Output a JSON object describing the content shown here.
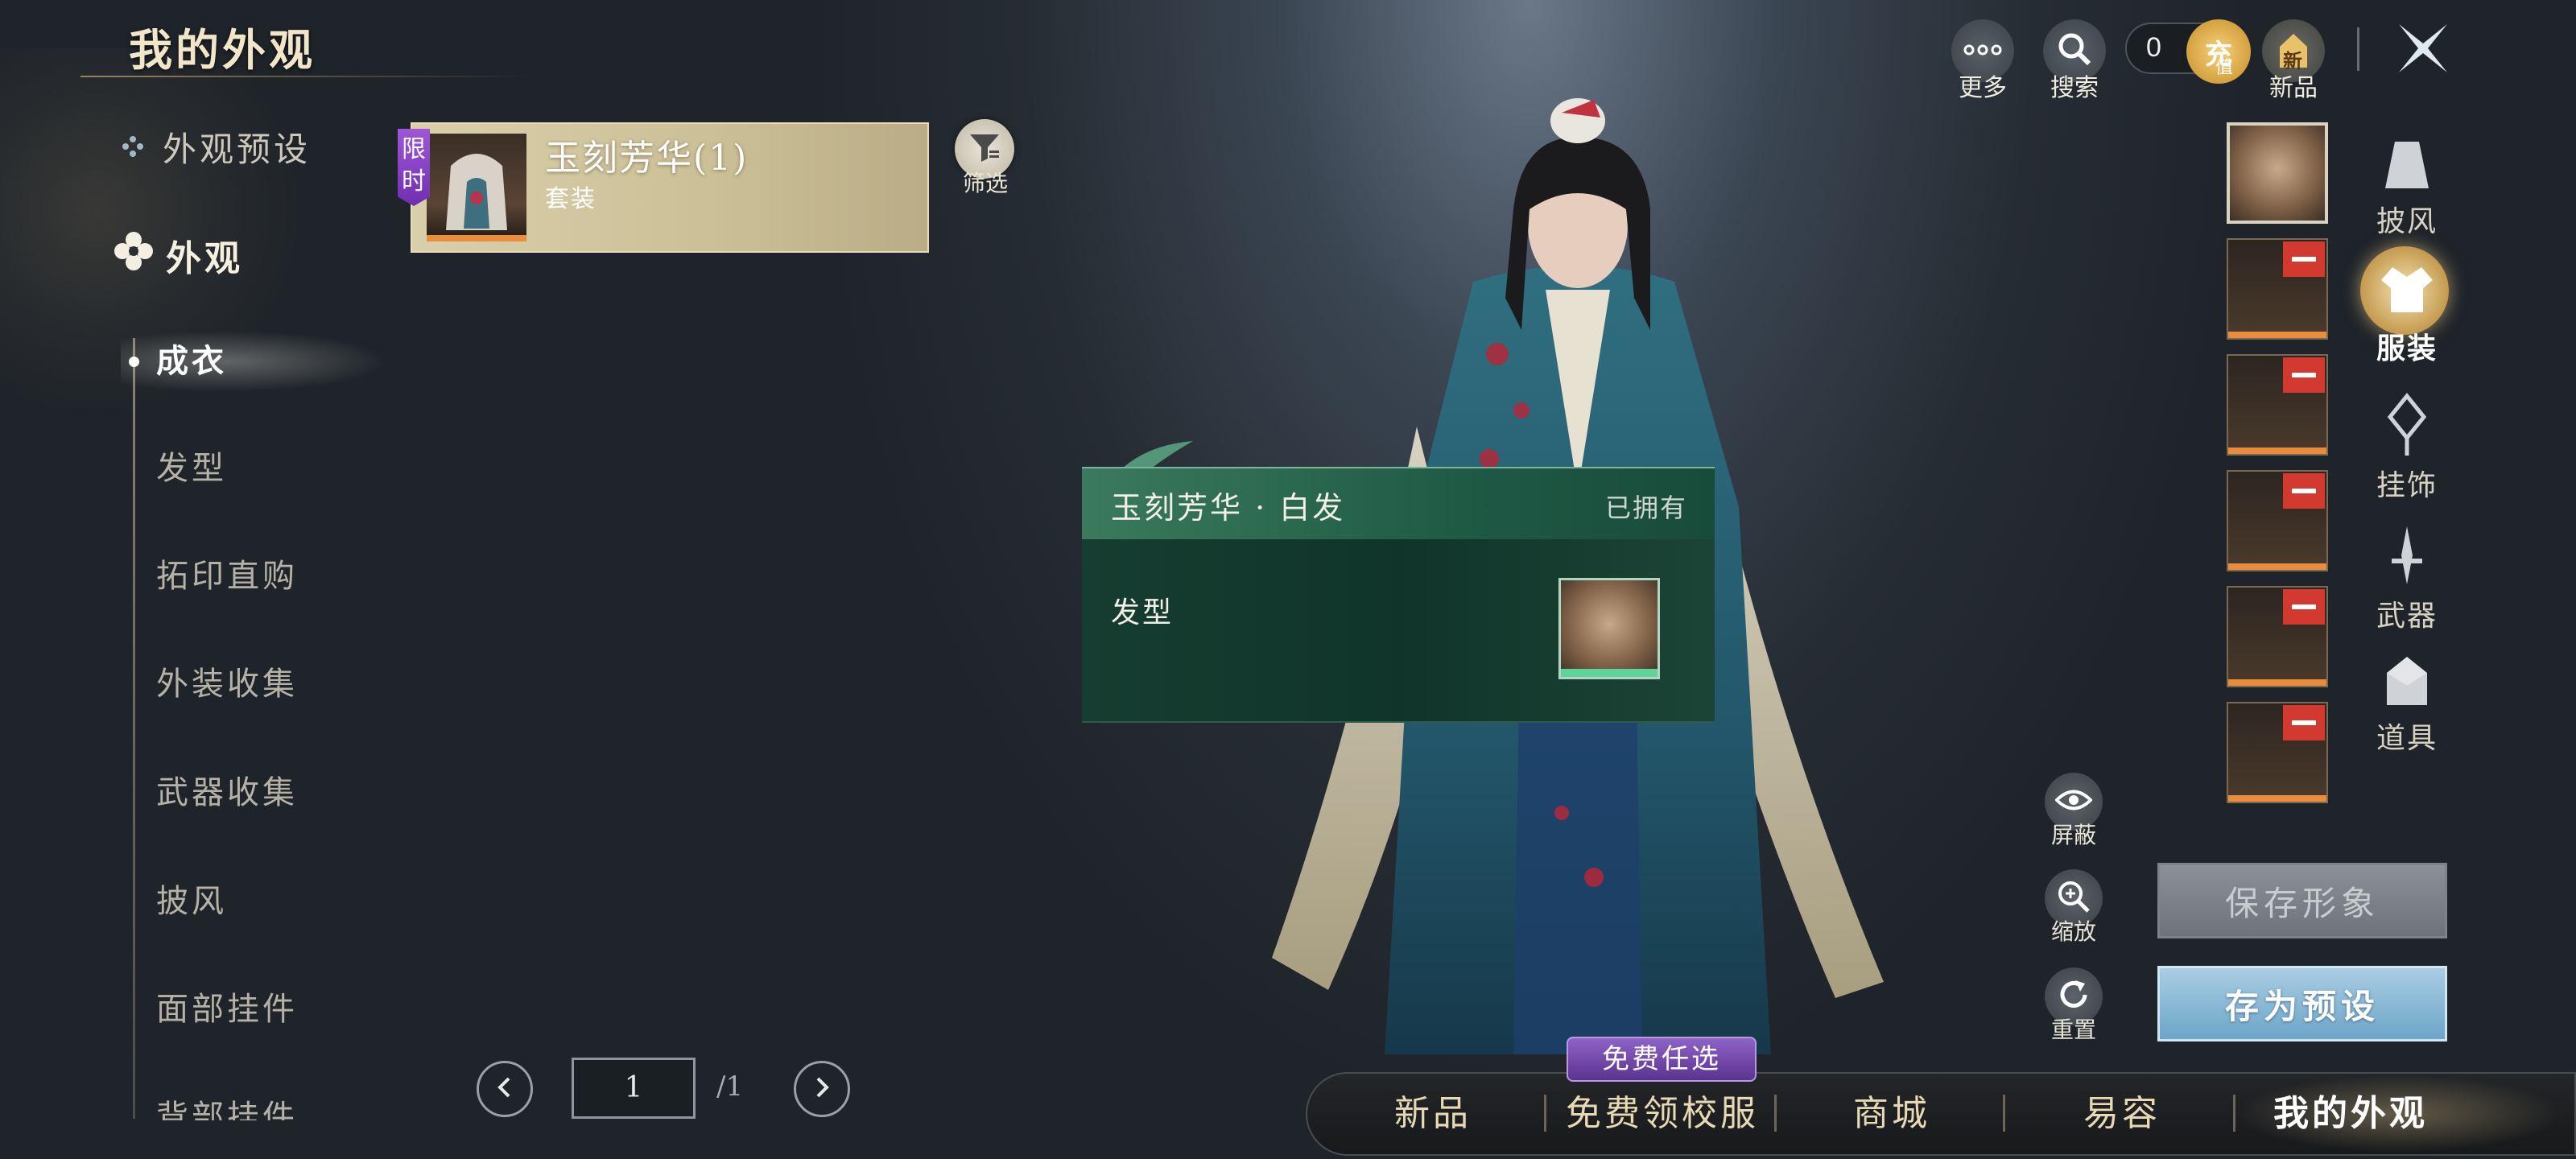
{
  "header": {
    "title": "我的外观"
  },
  "nav": {
    "preset_label": "外观预设",
    "look_label": "外观",
    "sub_items": [
      "成衣",
      "发型",
      "拓印直购",
      "外装收集",
      "武器收集",
      "披风",
      "面部挂件",
      "背部挂件"
    ],
    "active_index": 0
  },
  "item_list": {
    "items": [
      {
        "name": "玉刻芳华(1)",
        "type": "套装",
        "tag": "限时"
      }
    ],
    "filter_label": "筛选"
  },
  "pagination": {
    "current": "1",
    "total": "/1"
  },
  "popup": {
    "title": "玉刻芳华 · 白发",
    "status": "已拥有",
    "slot_label": "发型"
  },
  "top_bar": {
    "more_label": "更多",
    "search_label": "搜索",
    "currency_value": "0",
    "charge_label": "充",
    "charge_sub": "值",
    "new_label": "新品",
    "new_badge": "新"
  },
  "categories": [
    {
      "label": "披风",
      "icon": "cape-icon"
    },
    {
      "label": "服装",
      "icon": "outfit-icon",
      "active": true
    },
    {
      "label": "挂饰",
      "icon": "pendant-icon"
    },
    {
      "label": "武器",
      "icon": "weapon-icon"
    },
    {
      "label": "道具",
      "icon": "prop-icon"
    }
  ],
  "tools": {
    "hide_label": "屏蔽",
    "zoom_label": "缩放",
    "reset_label": "重置"
  },
  "buttons": {
    "save_look": "保存形象",
    "save_preset": "存为预设"
  },
  "bottom_tabs": {
    "badge": "免费任选",
    "tabs": [
      "新品",
      "免费领校服",
      "商城",
      "易容",
      "我的外观"
    ],
    "active_index": 4
  },
  "colors": {
    "accent_gold": "#e7d9b4",
    "popup_green": "#1f5a45",
    "remove_red": "#d23a2f",
    "limited_purple": "#8f4fcf"
  }
}
